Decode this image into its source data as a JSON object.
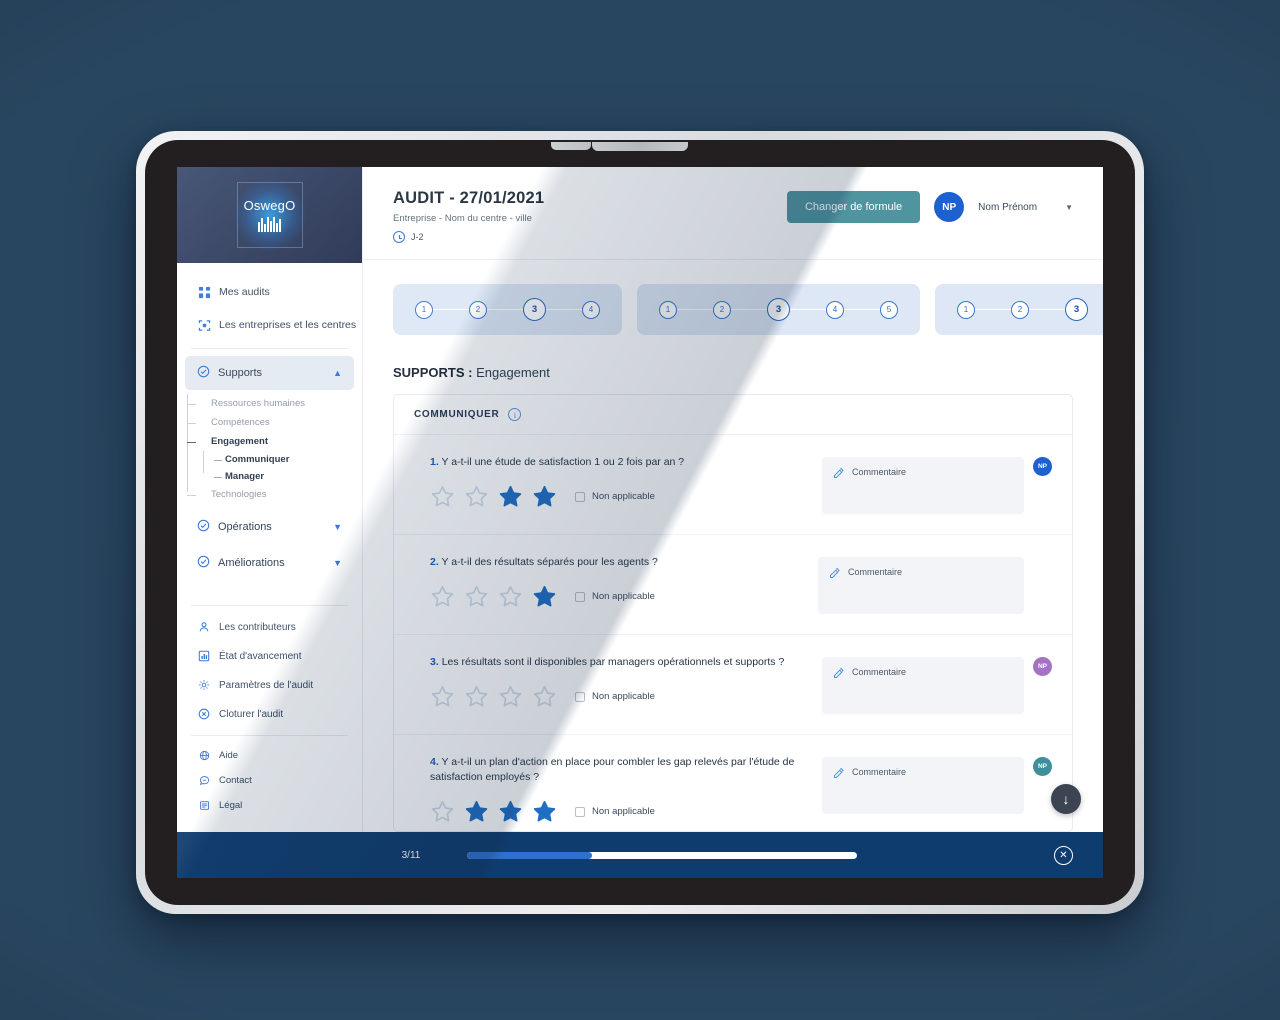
{
  "brand": {
    "logo_text": "OswegO",
    "sidebar_logo_bg": "#263457",
    "accent_blue": "#2d6fd1",
    "teal_button": "#4e95a0",
    "footer_navy": "#0f3c6e"
  },
  "sidebar": {
    "top_items": [
      {
        "label": "Mes audits",
        "icon": "grid-icon"
      },
      {
        "label": "Les entreprises et les centres",
        "icon": "scan-icon"
      }
    ],
    "groups": [
      {
        "label": "Supports",
        "icon": "check-circle-icon",
        "expanded": true,
        "chevron": "chevron-up-icon",
        "children": [
          {
            "label": "Ressources humaines",
            "active": false
          },
          {
            "label": "Compétences",
            "active": false
          },
          {
            "label": "Engagement",
            "active": true,
            "children": [
              {
                "label": "Communiquer"
              },
              {
                "label": "Manager"
              }
            ]
          },
          {
            "label": "Technologies",
            "active": false
          }
        ]
      },
      {
        "label": "Opérations",
        "icon": "check-circle-icon",
        "expanded": false,
        "chevron": "chevron-down-icon"
      },
      {
        "label": "Améliorations",
        "icon": "check-circle-icon",
        "expanded": false,
        "chevron": "chevron-down-icon"
      }
    ],
    "bottom_items": [
      {
        "label": "Les contributeurs",
        "icon": "user-icon"
      },
      {
        "label": "État d'avancement",
        "icon": "bar-chart-icon"
      },
      {
        "label": "Paramètres de l'audit",
        "icon": "gear-icon"
      },
      {
        "label": "Cloturer l'audit",
        "icon": "close-circle-icon"
      }
    ],
    "footer_items": [
      {
        "label": "Aide",
        "icon": "help-globe-icon"
      },
      {
        "label": "Contact",
        "icon": "chat-icon"
      },
      {
        "label": "Légal",
        "icon": "document-icon"
      }
    ]
  },
  "header": {
    "title": "AUDIT - 27/01/2021",
    "subtitle": "Entreprise - Nom du centre - ville",
    "deadline": "J-2",
    "deadline_icon": "clock-icon",
    "change_formula_button": "Changer de formule",
    "avatar_initials": "NP",
    "user_name": "Nom Prénom",
    "caret_icon": "caret-down-icon"
  },
  "steppers": [
    {
      "steps": [
        "1",
        "2",
        "3",
        "4"
      ],
      "current": 3
    },
    {
      "steps": [
        "1",
        "2",
        "3",
        "4",
        "5"
      ],
      "current": 3
    },
    {
      "steps": [
        "1",
        "2",
        "3"
      ],
      "current": 3
    }
  ],
  "section": {
    "prefix": "SUPPORTS :",
    "name": "Engagement"
  },
  "card": {
    "heading": "COMMUNIQUER",
    "info_icon": "info-icon",
    "max_stars": 4,
    "comment_placeholder": "Commentaire",
    "comment_icon": "pencil-square-icon",
    "not_applicable_label": "Non applicable",
    "questions": [
      {
        "number": "1.",
        "text": "Y a-t-il une étude de satisfaction 1 ou 2 fois par an ?",
        "filled_stars": [
          false,
          false,
          true,
          true
        ],
        "not_applicable": false,
        "avatar": {
          "initials": "NP",
          "color": "#1c61cf",
          "visible": true
        }
      },
      {
        "number": "2.",
        "text": "Y a-t-il des résultats séparés pour les agents ?",
        "filled_stars": [
          false,
          false,
          false,
          true
        ],
        "not_applicable": false,
        "avatar": {
          "initials": "NP",
          "color": "#1c61cf",
          "visible": false
        }
      },
      {
        "number": "3.",
        "text": "Les résultats sont il disponibles par managers opérationnels et supports ?",
        "filled_stars": [
          false,
          false,
          false,
          false
        ],
        "not_applicable": false,
        "avatar": {
          "initials": "NP",
          "color": "#a673c4",
          "visible": true
        }
      },
      {
        "number": "4.",
        "text": "Y a-t-il un plan d'action en place pour combler les gap relevés par l'étude de satisfaction employés ?",
        "filled_stars": [
          false,
          true,
          true,
          true
        ],
        "not_applicable": false,
        "avatar": {
          "initials": "NP",
          "color": "#3f8e9b",
          "visible": true
        }
      }
    ]
  },
  "scroll_button": {
    "icon": "arrow-down-icon"
  },
  "footer": {
    "progress_label": "3/11",
    "progress_percent": 32,
    "close_icon": "close-circle-icon"
  }
}
